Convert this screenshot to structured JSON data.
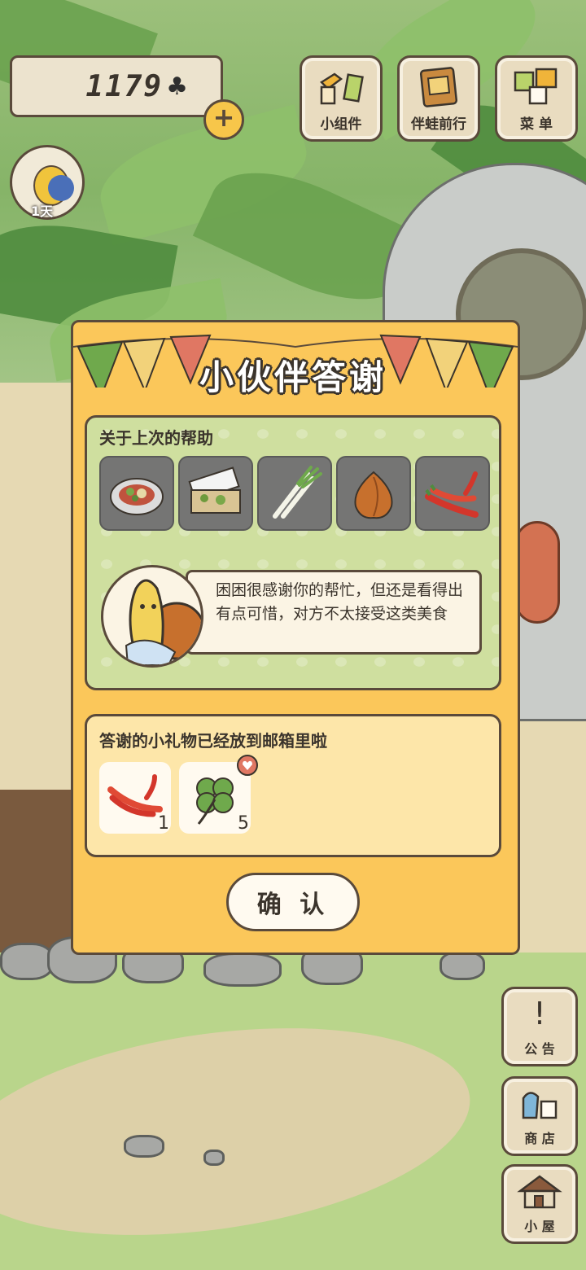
{
  "hud": {
    "clover_count": "1179",
    "clover_icon": "club-icon",
    "add_icon": "plus-icon",
    "day_label": "1天"
  },
  "top_buttons": [
    {
      "label": "小组件",
      "icon": "widget-icon"
    },
    {
      "label": "伴蛙前行",
      "icon": "journey-book-icon"
    },
    {
      "label": "菜 单",
      "icon": "menu-cards-icon"
    }
  ],
  "side_buttons": [
    {
      "label": "公 告",
      "icon": "exclamation-icon"
    },
    {
      "label": "商 店",
      "icon": "shop-bag-icon"
    },
    {
      "label": "小 屋",
      "icon": "house-icon"
    }
  ],
  "dialog": {
    "title": "小伙伴答谢",
    "help_section_label": "关于上次的帮助",
    "food_items": [
      "salad-plate-icon",
      "bento-box-icon",
      "green-onion-icon",
      "onion-icon",
      "chili-pepper-icon"
    ],
    "message": "困困很感谢你的帮忙，但还是看得出有点可惜，对方不太接受这类美食",
    "gift_section_label": "答谢的小礼物已经放到邮箱里啦",
    "gifts": [
      {
        "icon": "chili-pepper-icon",
        "quantity": "1"
      },
      {
        "icon": "four-leaf-clover-icon",
        "quantity": "5"
      }
    ],
    "confirm_label": "确 认"
  },
  "colors": {
    "dialog_bg": "#fbc75a",
    "help_panel_bg": "#cfdf9f",
    "gift_panel_bg": "#fde6a9",
    "outline": "#5a4a3b"
  }
}
